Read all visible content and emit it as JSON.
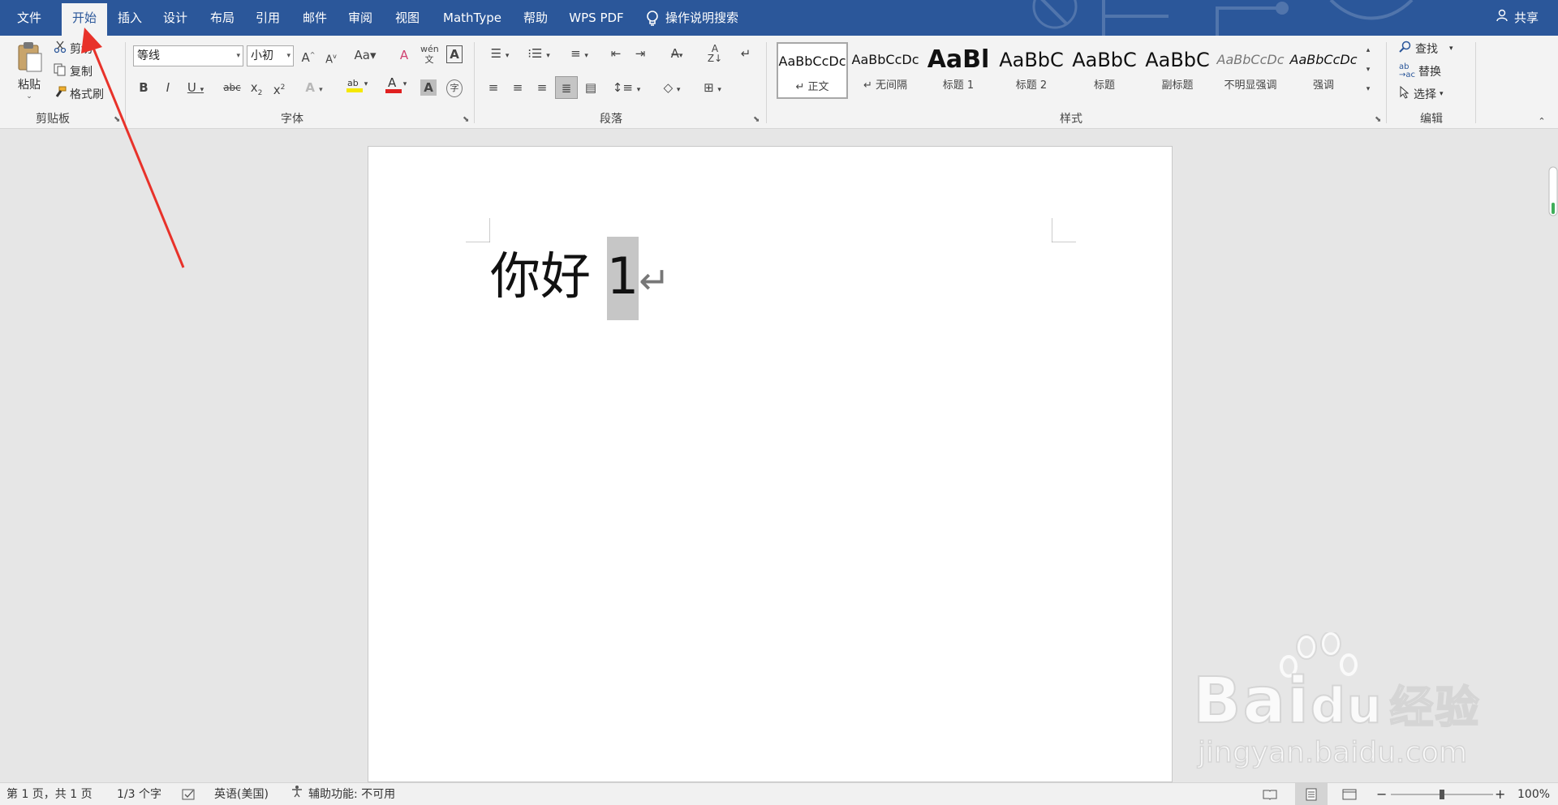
{
  "menubar": {
    "tabs": [
      {
        "label": "文件"
      },
      {
        "label": "开始"
      },
      {
        "label": "插入"
      },
      {
        "label": "设计"
      },
      {
        "label": "布局"
      },
      {
        "label": "引用"
      },
      {
        "label": "邮件"
      },
      {
        "label": "审阅"
      },
      {
        "label": "视图"
      },
      {
        "label": "MathType"
      },
      {
        "label": "帮助"
      },
      {
        "label": "WPS PDF"
      }
    ],
    "active_tab": "开始",
    "search_label": "操作说明搜索",
    "share_label": "共享",
    "bg_color": "#2b579a"
  },
  "ribbon": {
    "clipboard": {
      "paste_label": "粘贴",
      "cut_label": "剪切",
      "copy_label": "复制",
      "format_painter_label": "格式刷",
      "group_label": "剪贴板"
    },
    "font": {
      "font_name": "等线",
      "font_size": "小初",
      "group_label": "字体"
    },
    "paragraph": {
      "group_label": "段落"
    },
    "styles": {
      "items": [
        {
          "sample": "AaBbCcDc",
          "name": "正文"
        },
        {
          "sample": "AaBbCcDc",
          "name": "无间隔"
        },
        {
          "sample": "AaBl",
          "name": "标题 1"
        },
        {
          "sample": "AaBbC",
          "name": "标题 2"
        },
        {
          "sample": "AaBbC",
          "name": "标题"
        },
        {
          "sample": "AaBbC",
          "name": "副标题"
        },
        {
          "sample": "AaBbCcDc",
          "name": "不明显强调"
        },
        {
          "sample": "AaBbCcDc",
          "name": "强调"
        }
      ],
      "group_label": "样式"
    },
    "editing": {
      "find_label": "查找",
      "replace_label": "替换",
      "select_label": "选择",
      "group_label": "编辑"
    }
  },
  "document": {
    "text_plain": "你好 ",
    "text_selected": "1",
    "paragraph_mark": "↵"
  },
  "statusbar": {
    "page": "第 1 页，共 1 页",
    "words": "1/3 个字",
    "language": "英语(美国)",
    "accessibility": "辅助功能: 不可用",
    "zoom": "100%"
  },
  "watermark": {
    "brand": "Bai",
    "brand2": "du",
    "brand3": "经验",
    "url": "jingyan.baidu.com"
  },
  "colors": {
    "accent": "#2b579a",
    "arrow": "#e8322a",
    "font_color_bar": "#e02020",
    "highlight_bar": "#f5e800"
  }
}
